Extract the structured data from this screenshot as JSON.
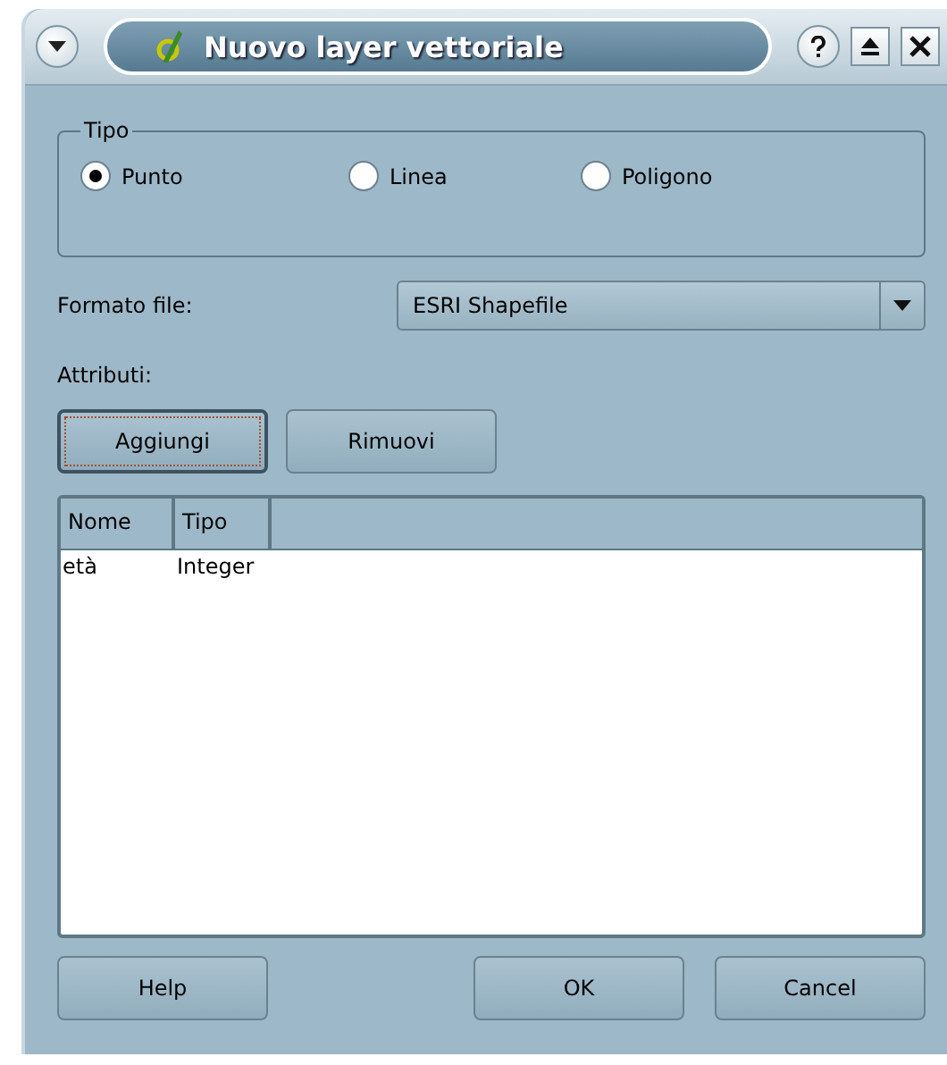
{
  "window": {
    "title": "Nuovo layer vettoriale"
  },
  "type_group": {
    "title": "Tipo",
    "options": [
      {
        "label": "Punto",
        "selected": true
      },
      {
        "label": "Linea",
        "selected": false
      },
      {
        "label": "Poligono",
        "selected": false
      }
    ]
  },
  "file_format": {
    "label": "Formato file:",
    "value": "ESRI Shapefile"
  },
  "attributes": {
    "label": "Attributi:",
    "buttons": [
      {
        "label": "Aggiungi",
        "focused": true
      },
      {
        "label": "Rimuovi",
        "focused": false
      }
    ]
  },
  "table": {
    "columns": [
      "Nome",
      "Tipo"
    ],
    "rows": [
      [
        "età",
        "Integer"
      ]
    ]
  },
  "buttons": [
    "Help",
    "OK",
    "Cancel"
  ]
}
